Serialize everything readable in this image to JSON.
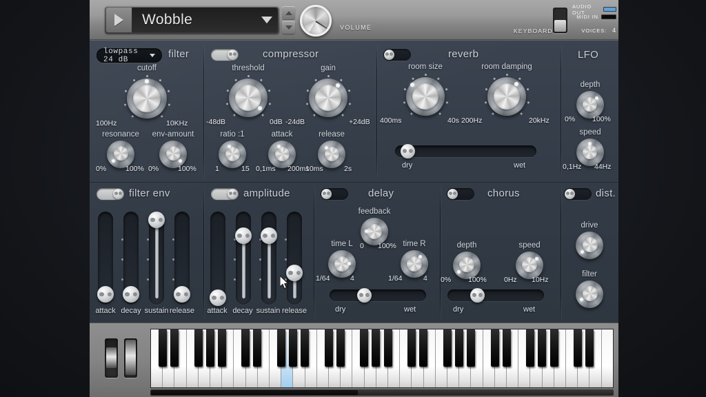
{
  "header": {
    "play_icon": "play-triangle-icon",
    "preset_name": "Wobble",
    "preset_dropdown_icon": "chevron-down-icon",
    "spinner_up_icon": "spinner-up-icon",
    "spinner_down_icon": "spinner-down-icon",
    "volume_label": "VOLUME",
    "keyboard_label": "KEYBOARD",
    "audio_out_label": "AUDIO OUT",
    "midi_in_label": "MIDI IN",
    "voices_label": "VOICES:",
    "voices_value": "4",
    "audio_out_color": "#5ba1dd",
    "midi_in_color": "#0b0b0b"
  },
  "sections": {
    "filter": {
      "title": "filter",
      "mode": "lowpass 24 dB",
      "mode_icon": "chevron-down-icon",
      "cutoff": {
        "label": "cutoff",
        "min": "100Hz",
        "max": "10KHz"
      },
      "resonance": {
        "label": "resonance",
        "min": "0%",
        "max": "100%"
      },
      "env_amount": {
        "label": "env-amount",
        "min": "0%",
        "max": "100%"
      }
    },
    "compressor": {
      "title": "compressor",
      "power": "on",
      "threshold": {
        "label": "threshold",
        "min": "-48dB",
        "max": "0dB"
      },
      "gain": {
        "label": "gain",
        "min": "-24dB",
        "max": "+24dB"
      },
      "ratio": {
        "label": "ratio :1",
        "min": "1",
        "max": "15"
      },
      "attack": {
        "label": "attack",
        "min": "0,1ms",
        "max": "200ms"
      },
      "release": {
        "label": "release",
        "min": "10ms",
        "max": "2s"
      }
    },
    "reverb": {
      "title": "reverb",
      "power": "off",
      "room_size": {
        "label": "room size",
        "min": "400ms",
        "max": "40s"
      },
      "room_damping": {
        "label": "room damping",
        "min": "200Hz",
        "max": "20kHz"
      },
      "mix": {
        "min": "dry",
        "max": "wet"
      }
    },
    "lfo": {
      "title": "LFO",
      "depth": {
        "label": "depth",
        "min": "0%",
        "max": "100%"
      },
      "speed": {
        "label": "speed",
        "min": "0,1Hz",
        "max": "44Hz"
      }
    },
    "filter_env": {
      "title": "filter env",
      "power": "on",
      "sliders": [
        {
          "label": "attack"
        },
        {
          "label": "decay"
        },
        {
          "label": "sustain"
        },
        {
          "label": "release"
        }
      ]
    },
    "amplitude": {
      "title": "amplitude",
      "power": "on",
      "sliders": [
        {
          "label": "attack"
        },
        {
          "label": "decay"
        },
        {
          "label": "sustain"
        },
        {
          "label": "release"
        }
      ]
    },
    "delay": {
      "title": "delay",
      "power": "off",
      "feedback": {
        "label": "feedback",
        "min": "0",
        "max": "100%"
      },
      "time_l": {
        "label": "time L",
        "min": "1/64",
        "max": "4"
      },
      "time_r": {
        "label": "time R",
        "min": "1/64",
        "max": "4"
      },
      "mix": {
        "min": "dry",
        "max": "wet"
      }
    },
    "chorus": {
      "title": "chorus",
      "power": "off",
      "depth": {
        "label": "depth",
        "min": "0%",
        "max": "100%"
      },
      "speed": {
        "label": "speed",
        "min": "0Hz",
        "max": "10Hz"
      },
      "mix": {
        "min": "dry",
        "max": "wet"
      }
    },
    "distortion": {
      "title": "dist.",
      "power": "off",
      "drive": {
        "label": "drive"
      },
      "filter": {
        "label": "filter"
      }
    }
  },
  "keyboard": {
    "pitch_wheel": "pitch-bend-wheel",
    "mod_wheel": "modulation-wheel",
    "active_key_color": "#9fcdef"
  }
}
